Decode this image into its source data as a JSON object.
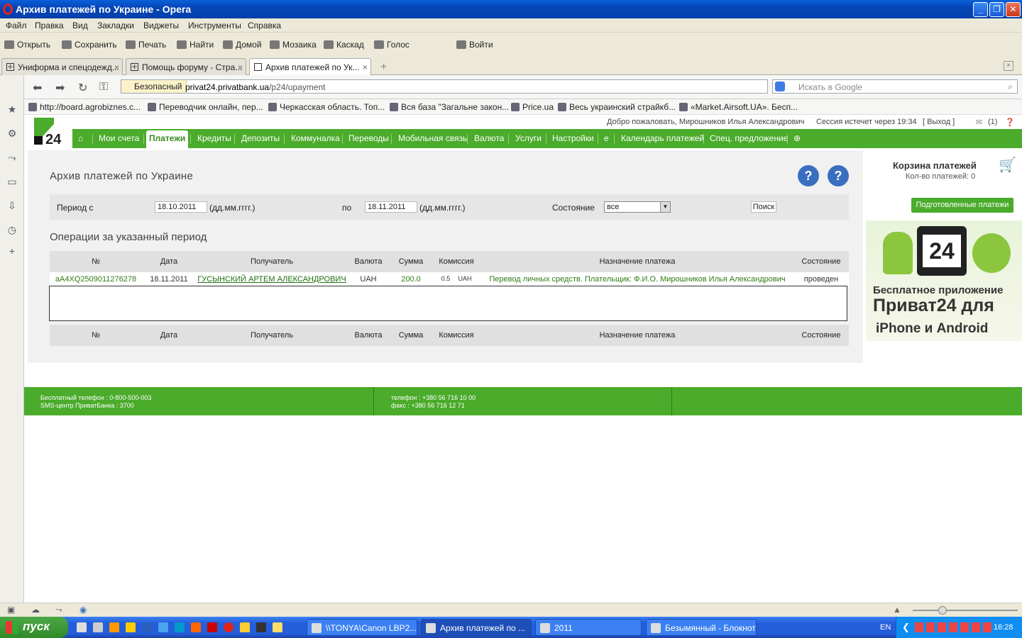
{
  "window": {
    "title": "Архив платежей по Украине - Opera"
  },
  "menu": [
    "Файл",
    "Правка",
    "Вид",
    "Закладки",
    "Виджеты",
    "Инструменты",
    "Справка"
  ],
  "toolbar": {
    "open": "Открыть",
    "save": "Сохранить",
    "print": "Печать",
    "find": "Найти",
    "home": "Домой",
    "mosaic": "Мозаика",
    "cascade": "Каскад",
    "voice": "Голос",
    "login": "Войти"
  },
  "tabs": [
    {
      "label": "Униформа и спецодежд..."
    },
    {
      "label": "Помощь форуму - Стра..."
    },
    {
      "label": "Архив платежей по Ук..."
    }
  ],
  "address": {
    "security": "Безопасный",
    "url_domain": "privat24.privatbank.ua",
    "url_path": "/p24/upayment",
    "search_placeholder": "Искать в Google"
  },
  "bookmarks": [
    "http://board.agrobiznes.c...",
    "Переводчик онлайн, пер...",
    "Черкасская область. Топ...",
    "Вся база \"Загальне закон...",
    "Price.ua",
    "Весь украинский страйкб...",
    "«Market.Airsoft.UA». Бесп..."
  ],
  "header": {
    "welcome": "Добро пожаловать, Мирошников Илья Александрович",
    "session": "Сессия истечет через 19:34",
    "logout": "[ Выход ]",
    "mail_count": "(1)"
  },
  "nav": [
    "Мои счета",
    "Платежи",
    "Кредиты",
    "Депозиты",
    "Коммуналка",
    "Переводы",
    "Мобильная связь",
    "Валюта",
    "Услуги",
    "Настройки",
    "е",
    "Календарь платежей",
    "Спец. предложение"
  ],
  "main": {
    "title": "Архив платежей по Украине",
    "period_label": "Период с",
    "date_from": "18.10.2011",
    "date_format1": "(дд.мм.гггг.)",
    "to_label": "по",
    "date_to": "18.11.2011",
    "date_format2": "(дд.мм.гггг.)",
    "state_label": "Состояние",
    "state_value": "все",
    "search_button": "Поиск",
    "section_title": "Операции за указанный период",
    "columns": [
      "№",
      "Дата",
      "Получатель",
      "Валюта",
      "Сумма",
      "Комиссия",
      "Назначение платежа",
      "Состояние"
    ],
    "row": {
      "id": "aA4XQ2509011276278",
      "date": "18.11.2011",
      "recipient": "ГУСЫНСКИЙ АРТЕМ АЛЕКСАНДРОВИЧ",
      "currency": "UAH",
      "amount": "200.0",
      "commission": "0.5",
      "commission_currency": "UAH",
      "purpose": "Перевод личных средств. Плательщик: Ф.И.О. Мирошников Илья Александрович",
      "state": "проведен"
    }
  },
  "cart": {
    "title": "Корзина платежей",
    "count": "Кол-во платежей: 0",
    "prepared": "Подготовленные платежи"
  },
  "ad": {
    "badge": "24",
    "line1": "Бесплатное приложение",
    "line2": "Приват24 для",
    "line3": "iPhone и Android"
  },
  "footer": {
    "phone_free": "Бесплатный телефон : 0-800-500-003",
    "sms": "SMS-центр ПриватБанка : 3700",
    "tel": "телефон :   +380 56 716 10 00",
    "fax": "факс      :   +380 56 716 12 71"
  },
  "taskbar": {
    "start": "пуск",
    "items": [
      "\\\\TONYA\\Canon LBP2...",
      "Архив платежей по ...",
      "2011",
      "Безымянный - Блокнот"
    ],
    "lang": "EN",
    "clock": "16:28"
  }
}
